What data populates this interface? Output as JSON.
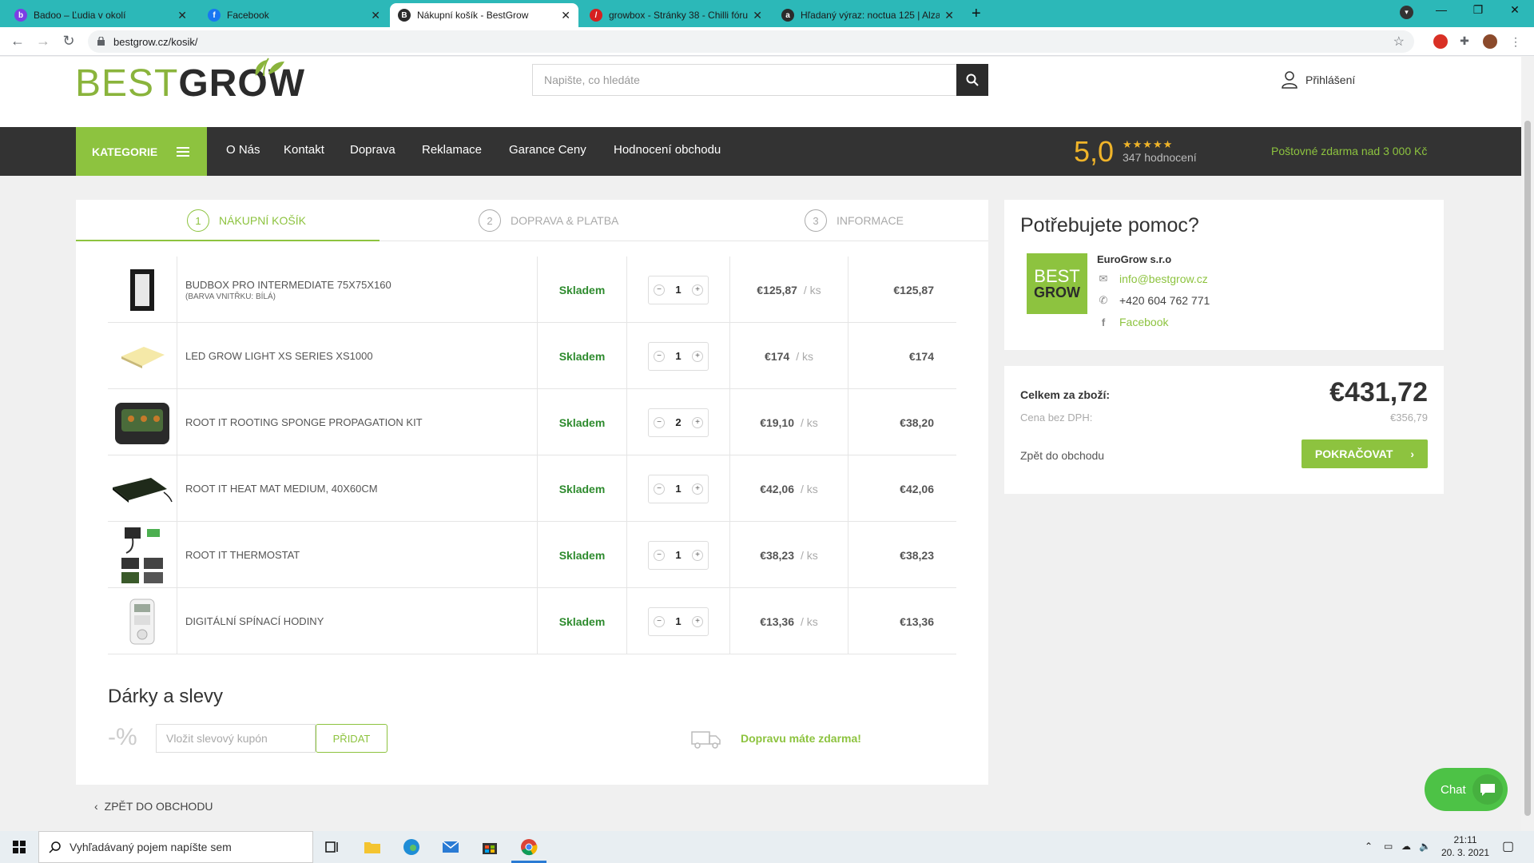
{
  "browser": {
    "tabs": [
      {
        "title": "Badoo – Ľudia v okolí",
        "color": "#7b3fe4",
        "glyph": "b",
        "active": false
      },
      {
        "title": "Facebook",
        "color": "#1877f2",
        "glyph": "f",
        "active": false
      },
      {
        "title": "Nákupní košík - BestGrow",
        "color": "#2b2b2b",
        "glyph": "B",
        "active": true
      },
      {
        "title": "growbox - Stránky 38 - Chilli fórum",
        "color": "#d62020",
        "glyph": "/",
        "active": false
      },
      {
        "title": "Hľadaný výraz: noctua 125 | Alza.sk",
        "color": "#2b2b2b",
        "glyph": "a",
        "active": false
      }
    ],
    "url": "bestgrow.cz/kosik/"
  },
  "header": {
    "logo_best": "BEST",
    "logo_grow": "GROW",
    "search_placeholder": "Napište, co hledáte",
    "login_label": "Přihlášení"
  },
  "nav": {
    "category_label": "KATEGORIE",
    "links": [
      "O Nás",
      "Kontakt",
      "Doprava",
      "Reklamace",
      "Garance Ceny",
      "Hodnocení obchodu"
    ],
    "rating": "5,0",
    "stars": "★★★★★",
    "rating_count": "347 hodnocení",
    "free_shipping": "Poštovné zdarma nad 3 000 Kč"
  },
  "steps": [
    {
      "num": "1",
      "label": "NÁKUPNÍ KOŠÍK"
    },
    {
      "num": "2",
      "label": "DOPRAVA & PLATBA"
    },
    {
      "num": "3",
      "label": "INFORMACE"
    }
  ],
  "cart": {
    "items": [
      {
        "name": "BUDBOX PRO INTERMEDIATE 75X75X160",
        "variant": "(BARVA VNITŘKU: BÍLÁ)",
        "stock": "Skladem",
        "qty": "1",
        "unit_price": "€125,87",
        "per": "/ ks",
        "total": "€125,87"
      },
      {
        "name": "LED GROW LIGHT XS SERIES XS1000",
        "variant": "",
        "stock": "Skladem",
        "qty": "1",
        "unit_price": "€174",
        "per": "/ ks",
        "total": "€174"
      },
      {
        "name": "ROOT IT ROOTING SPONGE PROPAGATION KIT",
        "variant": "",
        "stock": "Skladem",
        "qty": "2",
        "unit_price": "€19,10",
        "per": "/ ks",
        "total": "€38,20"
      },
      {
        "name": "ROOT IT HEAT MAT MEDIUM, 40X60CM",
        "variant": "",
        "stock": "Skladem",
        "qty": "1",
        "unit_price": "€42,06",
        "per": "/ ks",
        "total": "€42,06"
      },
      {
        "name": "ROOT IT THERMOSTAT",
        "variant": "",
        "stock": "Skladem",
        "qty": "1",
        "unit_price": "€38,23",
        "per": "/ ks",
        "total": "€38,23"
      },
      {
        "name": "DIGITÁLNÍ SPÍNACÍ HODINY",
        "variant": "",
        "stock": "Skladem",
        "qty": "1",
        "unit_price": "€13,36",
        "per": "/ ks",
        "total": "€13,36"
      }
    ],
    "gifts_title": "Dárky a slevy",
    "percent_glyph": "-%",
    "coupon_placeholder": "Vložit slevový kupón",
    "coupon_button": "PŘIDAT",
    "free_delivery": "Dopravu máte zdarma!",
    "back_label": "ZPĚT DO OBCHODU"
  },
  "help": {
    "title": "Potřebujete pomoc?",
    "logo_best": "BEST",
    "logo_grow": "GROW",
    "company": "EuroGrow s.r.o",
    "email": "info@bestgrow.cz",
    "phone": "+420 604 762 771",
    "facebook": "Facebook"
  },
  "summary": {
    "label": "Celkem za zboží:",
    "total": "€431,72",
    "net_label": "Cena bez DPH:",
    "net": "€356,79",
    "back": "Zpět do obchodu",
    "continue": "POKRAČOVAT"
  },
  "chat": {
    "label": "Chat"
  },
  "taskbar": {
    "search_placeholder": "Vyhľadávaný pojem napíšte sem",
    "time": "21:11",
    "date": "20. 3. 2021"
  }
}
